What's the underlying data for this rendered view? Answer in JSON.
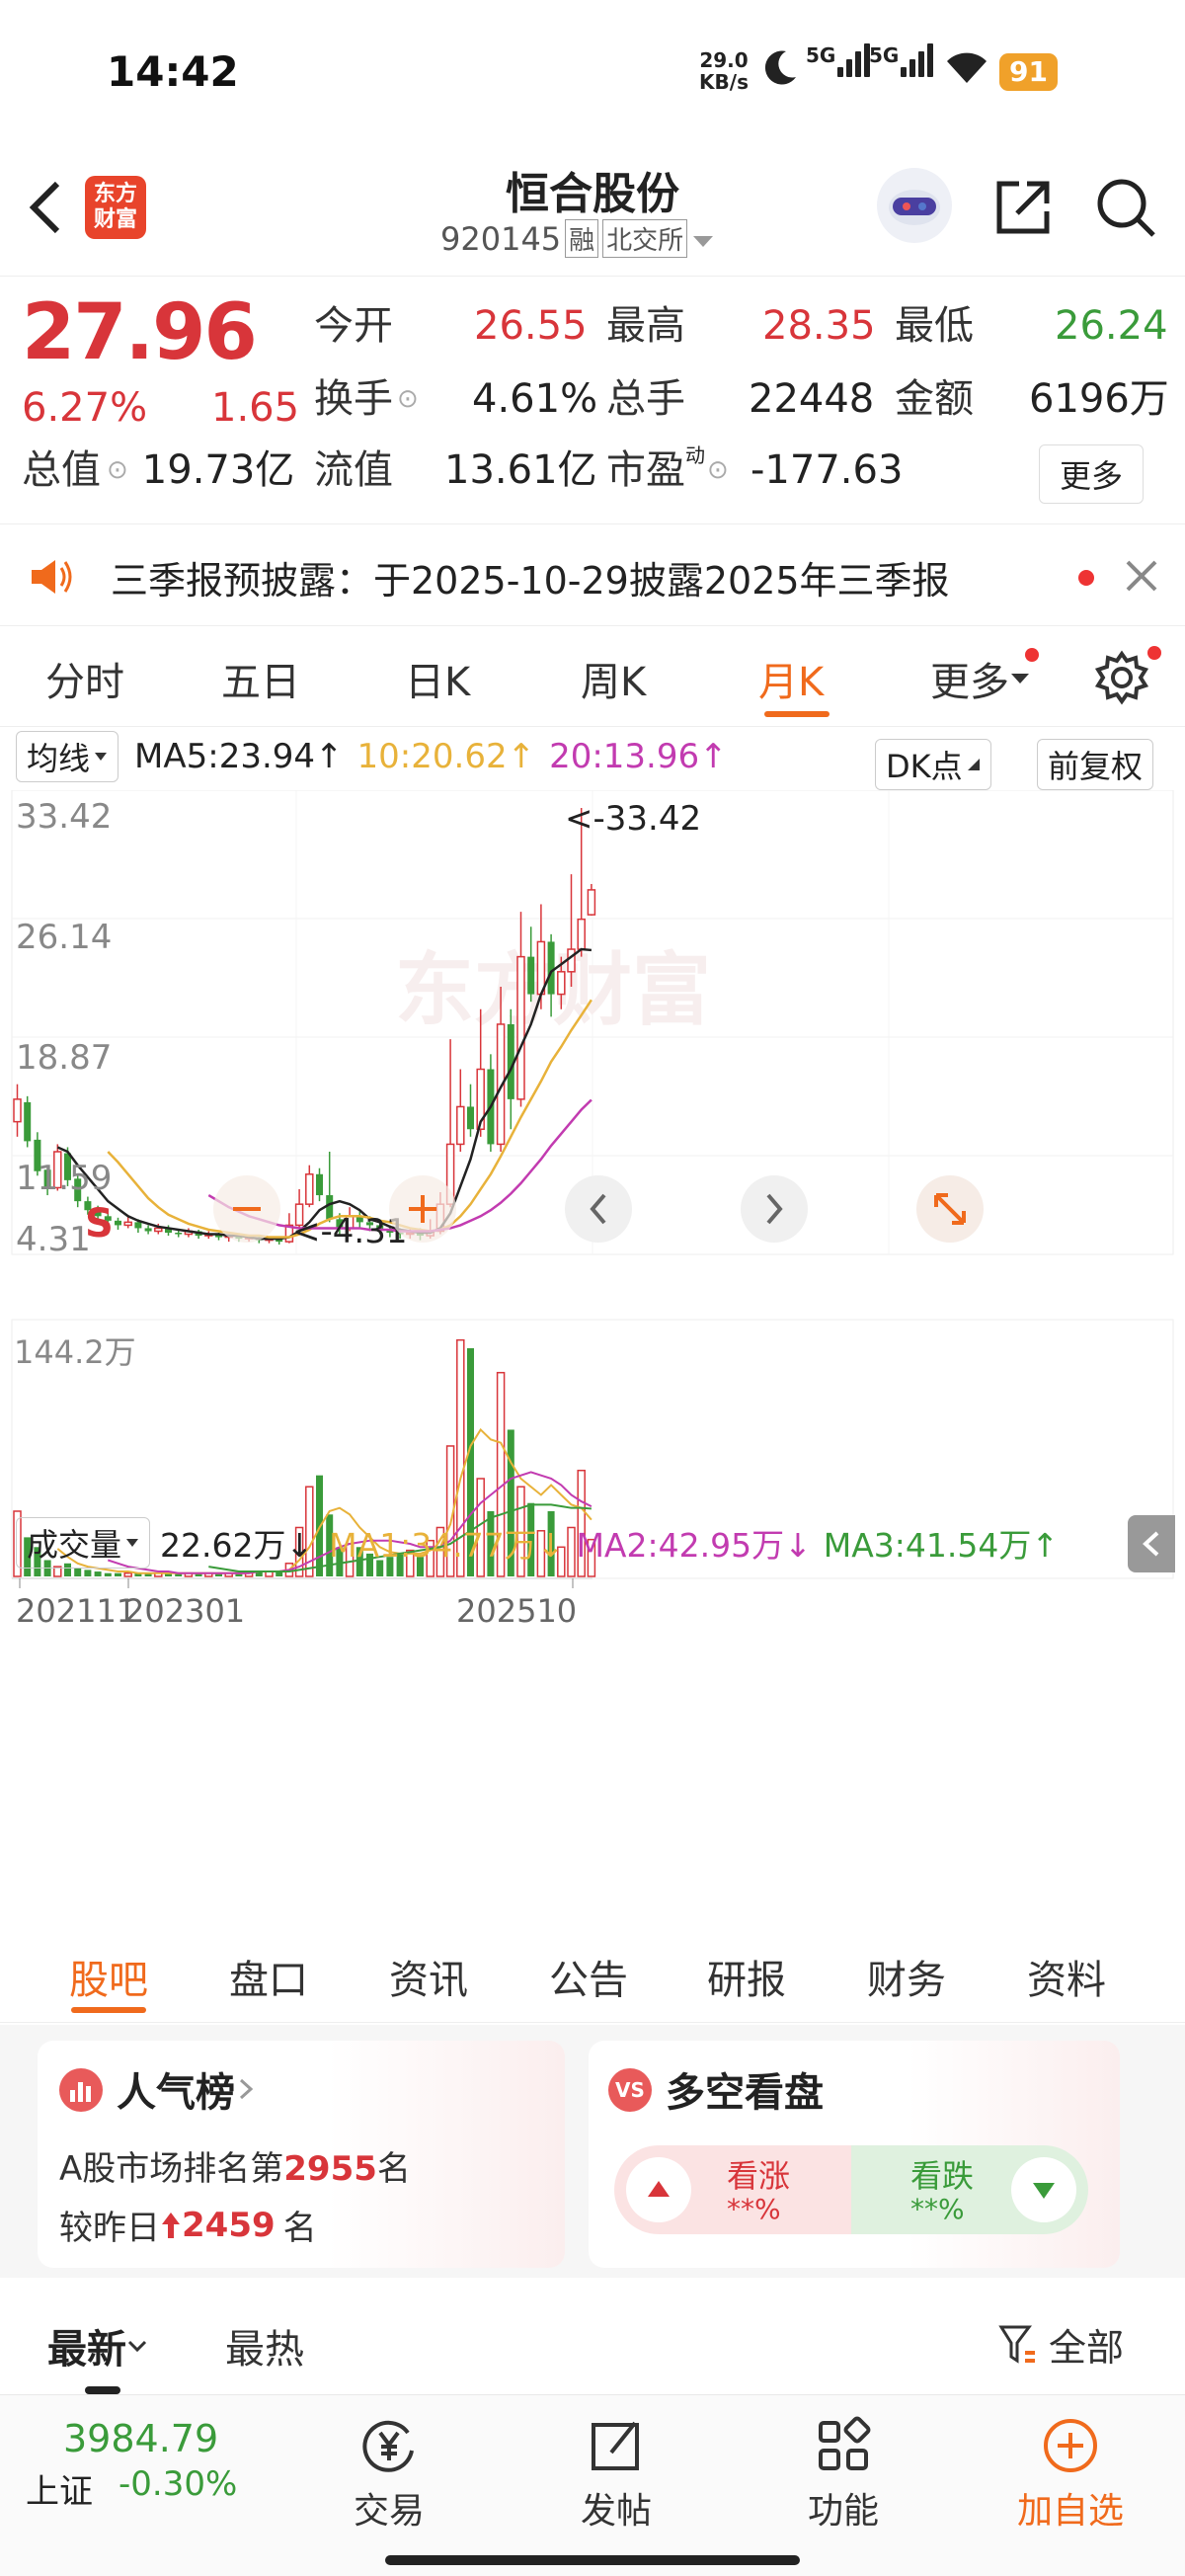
{
  "status_bar": {
    "time": "14:42",
    "speed_top": "29.0",
    "speed_bottom": "KB/s",
    "net1": "5G",
    "net2": "5G",
    "battery": "91"
  },
  "header": {
    "title": "恒合股份",
    "code": "920145",
    "tag_margin": "融",
    "tag_exchange": "北交所",
    "logo_line1": "东方",
    "logo_line2": "财富"
  },
  "quote": {
    "price": "27.96",
    "change_pct": "6.27%",
    "change": "1.65",
    "open_label": "今开",
    "open": "26.55",
    "high_label": "最高",
    "high": "28.35",
    "low_label": "最低",
    "low": "26.24",
    "turnover_label": "换手",
    "turnover": "4.61%",
    "volume_label": "总手",
    "volume": "22448",
    "amount_label": "金额",
    "amount": "6196万",
    "mcap_label": "总值",
    "mcap": "19.73亿",
    "float_label": "流值",
    "float_mcap": "13.61亿",
    "pe_label": "市盈",
    "pe_sup": "动",
    "pe": "-177.63",
    "more": "更多"
  },
  "notice": {
    "text": "三季报预披露：于2025-10-29披露2025年三季报"
  },
  "ktabs": [
    "分时",
    "五日",
    "日K",
    "周K",
    "月K",
    "更多"
  ],
  "ktabs_active": "月K",
  "ma_line": {
    "selector": "均线",
    "ma5": "MA5:23.94↑",
    "ma10": "10:20.62↑",
    "ma20": "20:13.96↑",
    "dk": "DK点",
    "adjust": "前复权"
  },
  "chart_labels": {
    "y_top": "33.42",
    "y2": "26.14",
    "y3": "18.87",
    "y4": "11.59",
    "y_bottom": "4.31",
    "max_marker": "<-33.42",
    "min_marker": "<-4.31",
    "s_marker": "S",
    "watermark": "东方财富"
  },
  "volume_line": {
    "selector": "成交量",
    "vol": "22.62万↓",
    "ma1": "MA1:34.77万↓",
    "ma2": "MA2:42.95万↓",
    "ma3": "MA3:41.54万↑",
    "y_max": "144.2万"
  },
  "x_labels": [
    "202111",
    "202301",
    "202510"
  ],
  "colors": {
    "up": "#d8353a",
    "down": "#3a9b3a",
    "accent": "#f06a1c",
    "ma5": "#222222",
    "ma10": "#e8b23a",
    "ma20": "#c23bb0"
  },
  "subtabs": [
    "股吧",
    "盘口",
    "资讯",
    "公告",
    "研报",
    "财务",
    "资料"
  ],
  "subtabs_active": "股吧",
  "popularity": {
    "title": "人气榜",
    "line1_prefix": "A股市场排名第",
    "rank": "2955",
    "line1_suffix": "名",
    "line2_prefix": "较昨日",
    "delta": "2459",
    "line2_suffix": "名"
  },
  "bullbear": {
    "title": "多空看盘",
    "up_label": "看涨",
    "up_value": "**%",
    "down_label": "看跌",
    "down_value": "**%"
  },
  "feed_tabs": {
    "latest": "最新",
    "hot": "最热",
    "filter": "全部"
  },
  "bottom": {
    "index_value": "3984.79",
    "index_name": "上证",
    "index_change": "-0.30%",
    "trade": "交易",
    "post": "发帖",
    "func": "功能",
    "add": "加自选"
  },
  "chart_data": {
    "type": "candlestick",
    "ylim": [
      4.31,
      33.42
    ],
    "candles": [
      [
        12.5,
        14.0,
        15.0,
        11.5
      ],
      [
        13.8,
        11.2,
        14.2,
        10.8
      ],
      [
        11.3,
        9.2,
        11.8,
        8.9
      ],
      [
        9.3,
        8.0,
        9.6,
        7.6
      ],
      [
        8.1,
        10.5,
        11.0,
        7.9
      ],
      [
        10.4,
        8.6,
        10.8,
        8.2
      ],
      [
        8.7,
        7.2,
        9.0,
        6.8
      ],
      [
        7.2,
        6.6,
        7.5,
        6.3
      ],
      [
        6.6,
        6.2,
        6.9,
        5.9
      ],
      [
        6.2,
        5.9,
        6.4,
        5.6
      ],
      [
        5.9,
        5.6,
        6.1,
        5.3
      ],
      [
        5.6,
        5.8,
        6.2,
        5.4
      ],
      [
        5.8,
        5.4,
        6.0,
        5.1
      ],
      [
        5.4,
        5.2,
        5.6,
        5.0
      ],
      [
        5.2,
        5.4,
        5.7,
        5.0
      ],
      [
        5.4,
        5.1,
        5.6,
        4.9
      ],
      [
        5.1,
        5.0,
        5.3,
        4.8
      ],
      [
        5.0,
        5.2,
        5.4,
        4.8
      ],
      [
        5.2,
        4.9,
        5.3,
        4.7
      ],
      [
        4.9,
        5.0,
        5.2,
        4.7
      ],
      [
        5.0,
        4.8,
        5.1,
        4.6
      ],
      [
        4.8,
        4.9,
        5.0,
        4.5
      ],
      [
        4.9,
        4.7,
        5.0,
        4.5
      ],
      [
        4.7,
        4.8,
        4.9,
        4.5
      ],
      [
        4.8,
        4.6,
        4.9,
        4.4
      ],
      [
        4.6,
        4.7,
        4.8,
        4.4
      ],
      [
        4.7,
        4.5,
        4.8,
        4.31
      ],
      [
        4.5,
        5.6,
        6.4,
        4.4
      ],
      [
        5.6,
        7.0,
        8.0,
        5.4
      ],
      [
        7.0,
        9.0,
        9.6,
        6.8
      ],
      [
        9.0,
        7.6,
        9.4,
        7.2
      ],
      [
        7.6,
        6.0,
        10.5,
        5.8
      ],
      [
        6.0,
        5.4,
        6.4,
        5.0
      ],
      [
        5.4,
        6.2,
        6.8,
        5.2
      ],
      [
        6.2,
        5.8,
        6.6,
        5.4
      ],
      [
        5.8,
        5.6,
        6.2,
        5.2
      ],
      [
        5.6,
        5.3,
        6.0,
        5.0
      ],
      [
        5.3,
        5.1,
        5.6,
        4.8
      ],
      [
        5.1,
        5.0,
        5.4,
        4.7
      ],
      [
        5.0,
        5.1,
        5.4,
        4.7
      ],
      [
        5.1,
        4.9,
        5.4,
        4.6
      ],
      [
        4.9,
        5.2,
        6.0,
        4.7
      ],
      [
        5.2,
        7.0,
        7.8,
        5.0
      ],
      [
        7.0,
        11.0,
        18.0,
        6.8
      ],
      [
        11.0,
        13.5,
        16.0,
        10.5
      ],
      [
        13.5,
        12.0,
        15.0,
        11.5
      ],
      [
        12.0,
        16.0,
        20.0,
        11.5
      ],
      [
        16.0,
        11.0,
        17.0,
        10.5
      ],
      [
        11.0,
        19.0,
        21.5,
        10.5
      ],
      [
        19.0,
        14.0,
        20.0,
        12.0
      ],
      [
        14.0,
        23.5,
        26.5,
        13.5
      ],
      [
        23.5,
        21.0,
        25.5,
        20.5
      ],
      [
        21.0,
        24.5,
        27.0,
        20.0
      ],
      [
        24.5,
        21.0,
        25.0,
        19.5
      ],
      [
        21.0,
        22.5,
        23.5,
        20.0
      ],
      [
        22.5,
        24.0,
        29.0,
        21.5
      ],
      [
        24.0,
        26.0,
        33.42,
        23.5
      ],
      [
        26.3,
        27.96,
        28.35,
        26.24
      ]
    ],
    "ma5": [
      null,
      null,
      null,
      null,
      10.8,
      10.5,
      9.6,
      8.8,
      8.0,
      7.2,
      6.7,
      6.2,
      5.9,
      5.7,
      5.5,
      5.4,
      5.3,
      5.2,
      5.1,
      5.0,
      5.0,
      4.9,
      4.9,
      4.8,
      4.7,
      4.7,
      4.7,
      4.8,
      5.2,
      5.8,
      6.6,
      7.0,
      7.2,
      7.0,
      6.6,
      6.0,
      5.8,
      5.5,
      5.3,
      5.2,
      5.1,
      5.1,
      5.4,
      6.4,
      8.2,
      10.0,
      12.5,
      13.5,
      14.8,
      16.0,
      17.5,
      19.0,
      21.0,
      22.5,
      23.0,
      23.5,
      24.0,
      23.94
    ],
    "ma10": [
      null,
      null,
      null,
      null,
      null,
      null,
      null,
      null,
      null,
      10.5,
      9.8,
      9.0,
      8.2,
      7.4,
      6.8,
      6.3,
      6.0,
      5.7,
      5.5,
      5.3,
      5.2,
      5.1,
      5.0,
      4.9,
      4.9,
      4.8,
      4.8,
      4.8,
      5.0,
      5.3,
      5.7,
      6.0,
      6.2,
      6.2,
      6.2,
      6.1,
      5.9,
      5.8,
      5.6,
      5.4,
      5.3,
      5.2,
      5.3,
      5.6,
      6.2,
      7.0,
      8.0,
      9.0,
      10.2,
      11.5,
      12.8,
      14.0,
      15.2,
      16.5,
      17.5,
      18.6,
      19.6,
      20.62
    ],
    "ma20": [
      null,
      null,
      null,
      null,
      null,
      null,
      null,
      null,
      null,
      null,
      null,
      null,
      null,
      null,
      null,
      null,
      null,
      null,
      null,
      7.6,
      7.2,
      6.8,
      6.5,
      6.2,
      6.0,
      5.8,
      5.6,
      5.5,
      5.4,
      5.4,
      5.4,
      5.4,
      5.4,
      5.4,
      5.4,
      5.3,
      5.3,
      5.3,
      5.2,
      5.2,
      5.2,
      5.2,
      5.3,
      5.4,
      5.6,
      5.9,
      6.2,
      6.6,
      7.1,
      7.7,
      8.4,
      9.2,
      10.0,
      10.9,
      11.7,
      12.5,
      13.3,
      13.96
    ],
    "volume_unit": "万",
    "vol_max": 144.2,
    "volumes": [
      40,
      24,
      18,
      10,
      6,
      8,
      5,
      4,
      3,
      2,
      2,
      2,
      2,
      2,
      2,
      2,
      2,
      2,
      2,
      2,
      2,
      2,
      2,
      3,
      3,
      3,
      3,
      8,
      30,
      55,
      62,
      38,
      18,
      20,
      18,
      14,
      10,
      12,
      14,
      16,
      12,
      22,
      30,
      80,
      145,
      140,
      60,
      40,
      125,
      90,
      55,
      45,
      28,
      40,
      18,
      30,
      65,
      22.62
    ],
    "ma_vol1": [
      null,
      null,
      null,
      null,
      17,
      12,
      8,
      6,
      5,
      4,
      3,
      3,
      2,
      2,
      2,
      2,
      2,
      2,
      2,
      2,
      2,
      2,
      2,
      2,
      3,
      3,
      3,
      4,
      10,
      18,
      30,
      40,
      42,
      38,
      30,
      24,
      18,
      15,
      14,
      14,
      14,
      16,
      18,
      32,
      60,
      80,
      90,
      84,
      82,
      70,
      60,
      55,
      50,
      56,
      50,
      44,
      42,
      34.77
    ],
    "ma_vol2": [
      null,
      null,
      null,
      null,
      null,
      null,
      null,
      null,
      null,
      10,
      8,
      6,
      5,
      4,
      3,
      3,
      2,
      2,
      2,
      2,
      2,
      2,
      2,
      2,
      3,
      3,
      3,
      4,
      6,
      9,
      12,
      15,
      18,
      20,
      21,
      22,
      22,
      22,
      21,
      20,
      18,
      18,
      18,
      22,
      30,
      38,
      45,
      50,
      55,
      60,
      62,
      64,
      62,
      60,
      56,
      50,
      46,
      42.95
    ],
    "ma_vol3": [
      null,
      null,
      null,
      null,
      null,
      null,
      null,
      null,
      null,
      null,
      null,
      null,
      null,
      null,
      null,
      null,
      null,
      null,
      null,
      6,
      5,
      4,
      3,
      3,
      3,
      3,
      3,
      3,
      4,
      5,
      6,
      7,
      8,
      9,
      10,
      11,
      12,
      13,
      14,
      15,
      16,
      17,
      18,
      20,
      24,
      28,
      32,
      36,
      38,
      40,
      42,
      44,
      44,
      44,
      43,
      42,
      42,
      41.54
    ]
  }
}
